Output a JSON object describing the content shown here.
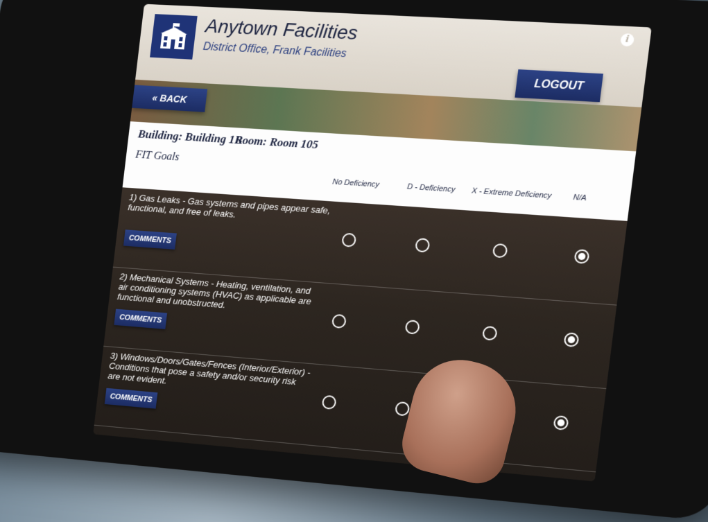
{
  "app": {
    "title": "Anytown Facilities",
    "subtitle": "District Office, Frank Facilities",
    "logout_label": "LOGOUT",
    "back_label": "« BACK",
    "info_icon": "i"
  },
  "location": {
    "building": "Building: Building 1B",
    "room": "Room: Room 105",
    "section": "FIT Goals"
  },
  "columns": [
    "No Deficiency",
    "D - Deficiency",
    "X - Extreme Deficiency",
    "N/A"
  ],
  "items": [
    {
      "question": "1) Gas Leaks - Gas systems and pipes appear safe, functional, and free of leaks.",
      "comments_label": "COMMENTS",
      "selected": "N/A"
    },
    {
      "question": "2) Mechanical Systems - Heating, ventilation, and air conditioning systems (HVAC) as applicable are functional and unobstructed.",
      "comments_label": "COMMENTS",
      "selected": "N/A"
    },
    {
      "question": "3) Windows/Doors/Gates/Fences (Interior/Exterior) - Conditions that pose a safety and/or security risk are not evident.",
      "comments_label": "COMMENTS",
      "selected": "N/A"
    }
  ],
  "colors": {
    "brand_navy": "#1f3377",
    "button_navy": "#24397a",
    "header_bg": "#e5dfd5"
  }
}
